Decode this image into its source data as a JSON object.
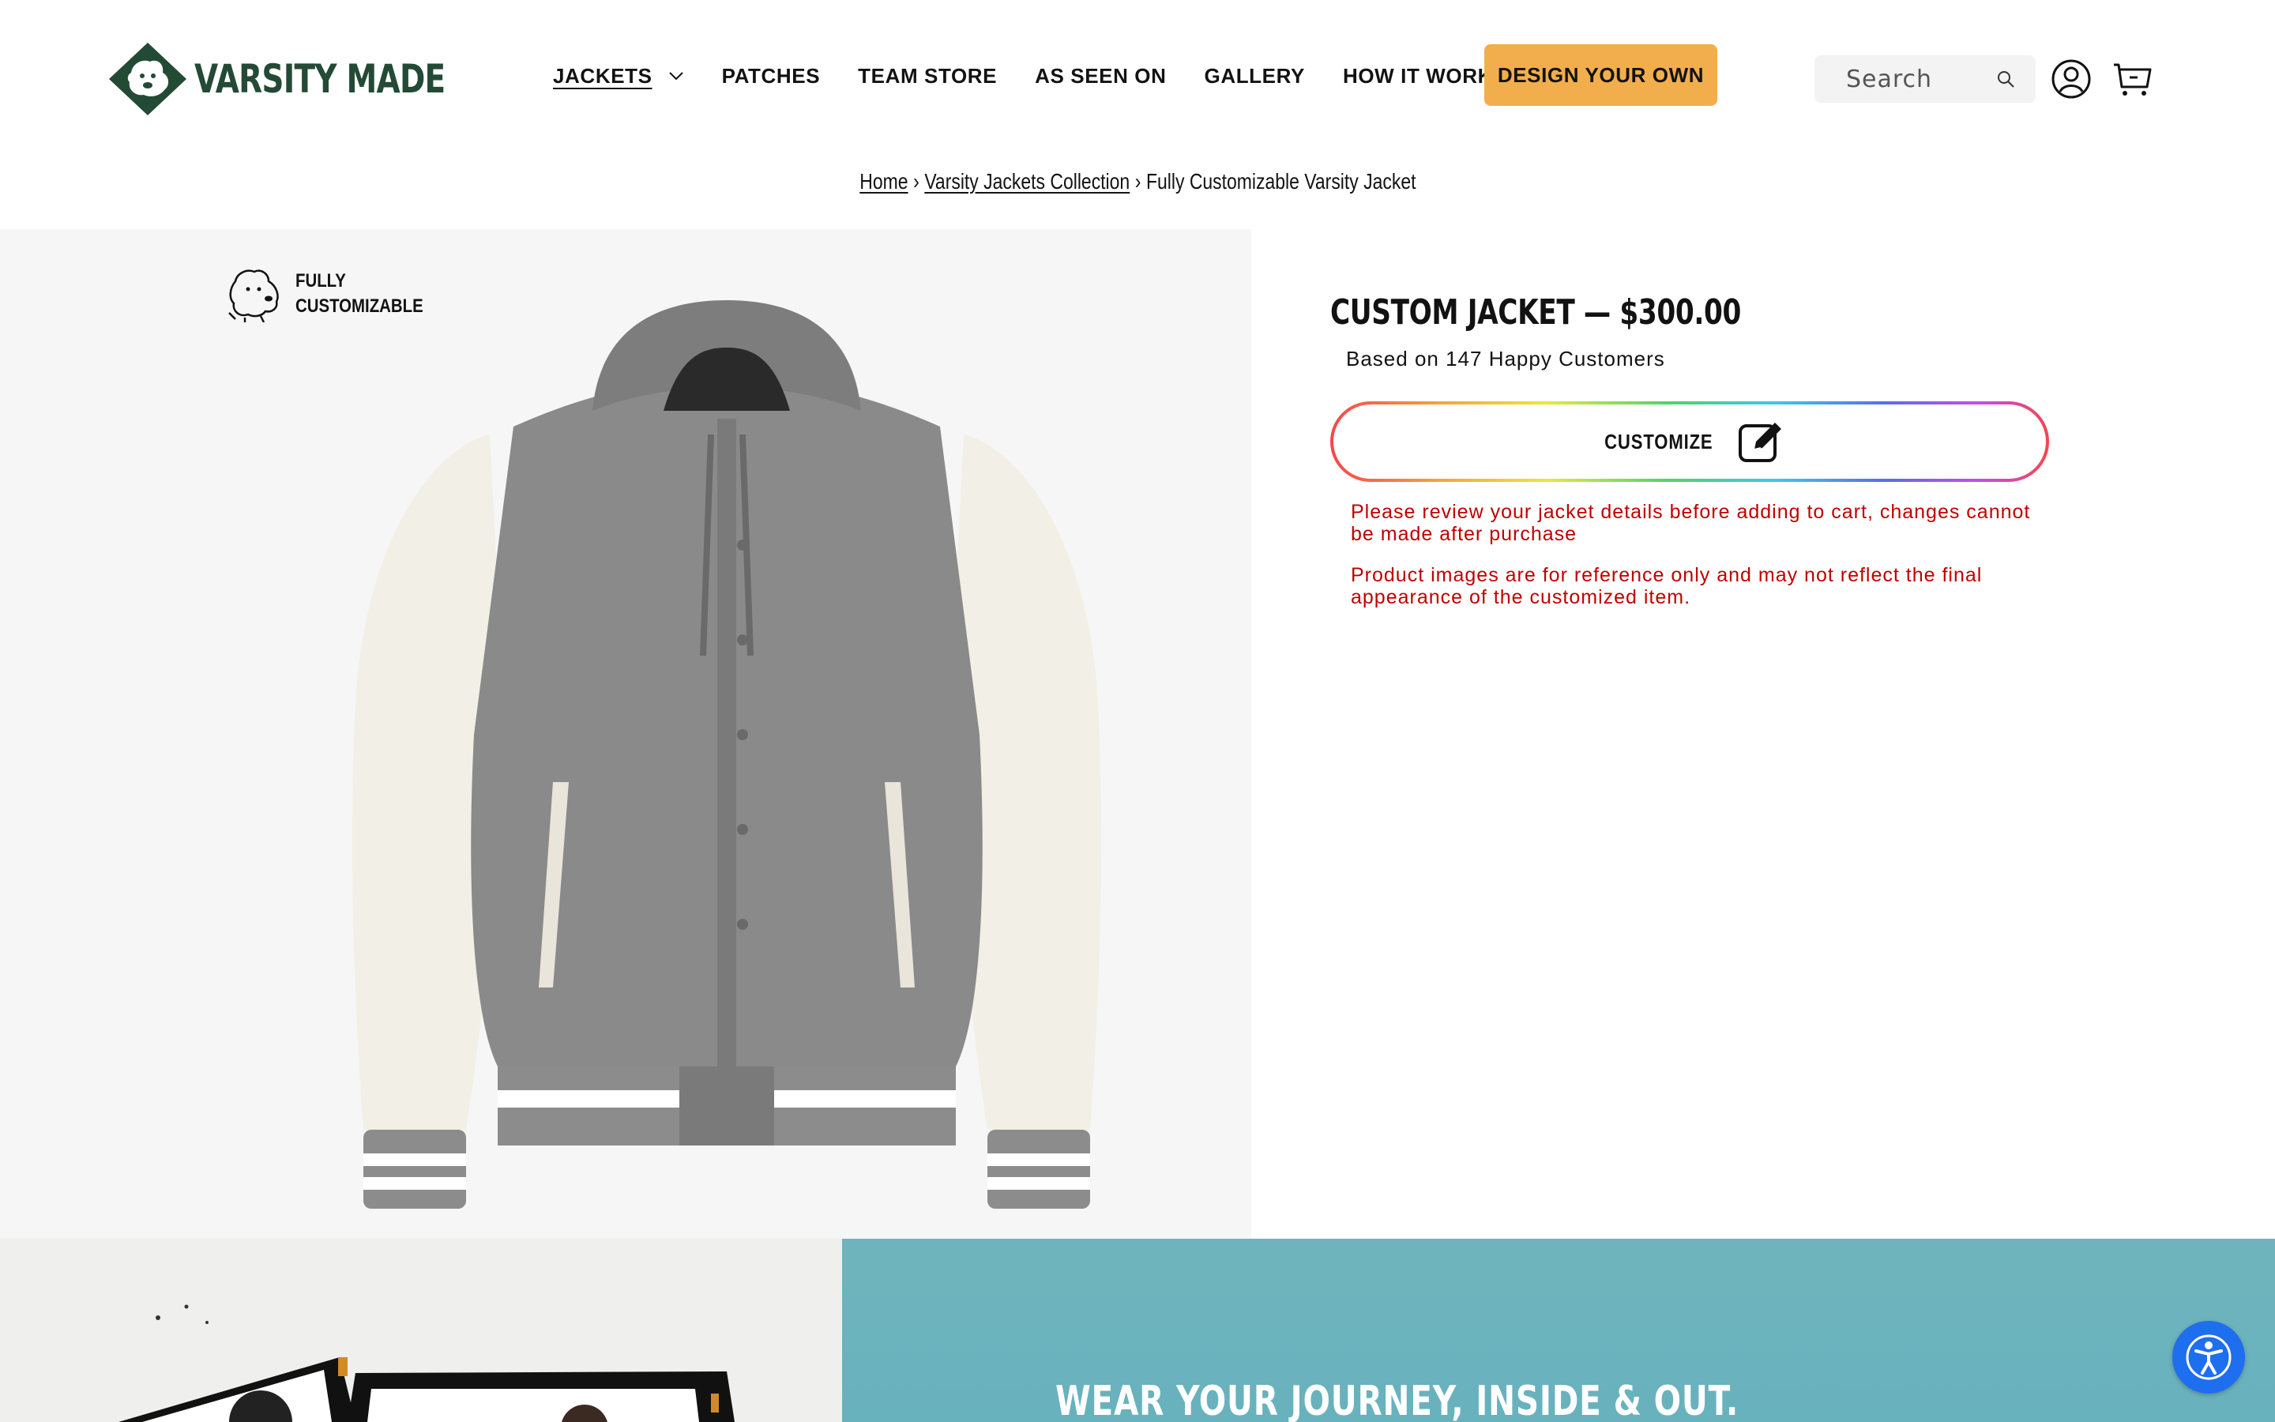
{
  "brand": {
    "name": "VARSITY MADE",
    "color": "#234a35"
  },
  "nav": {
    "items": [
      {
        "label": "JACKETS",
        "active": true,
        "has_dropdown": true
      },
      {
        "label": "PATCHES"
      },
      {
        "label": "TEAM STORE"
      },
      {
        "label": "AS SEEN ON"
      },
      {
        "label": "GALLERY"
      },
      {
        "label": "HOW IT WORKS"
      }
    ],
    "cta_label": "DESIGN YOUR OWN",
    "cta_color": "#f2ae4c"
  },
  "search": {
    "placeholder": "Search"
  },
  "breadcrumb": {
    "home": "Home",
    "collection": "Varsity Jackets Collection",
    "current": "Fully Customizable Varsity Jacket",
    "separator": "›"
  },
  "gallery": {
    "badge_line1": "FULLY",
    "badge_line2": "CUSTOMIZABLE"
  },
  "product": {
    "title": "CUSTOM JACKET — $300.00",
    "reviews": "Based on 147 Happy Customers",
    "customize_label": "CUSTOMIZE",
    "warning_1": "Please review your jacket details before adding to cart, changes cannot be made after purchase",
    "warning_2": "Product images are for reference only and may not reflect the final appearance of the customized item.",
    "warning_color": "#c00000"
  },
  "banner": {
    "headline": "WEAR YOUR JOURNEY, INSIDE & OUT."
  },
  "icons": {
    "search": "search-icon",
    "account": "account-icon",
    "cart": "cart-icon",
    "edit": "edit-icon",
    "accessibility": "accessibility-icon"
  }
}
